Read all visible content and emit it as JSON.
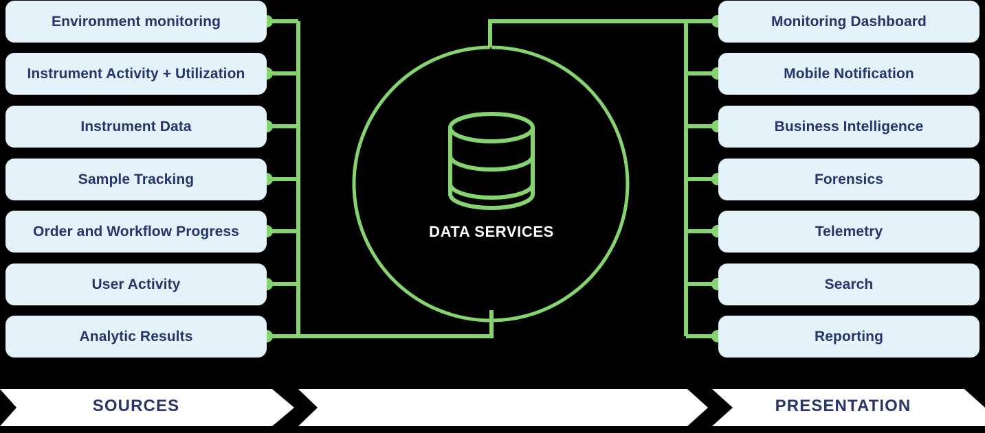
{
  "diagram": {
    "title": "Data Services architecture diagram",
    "colors": {
      "background": "#000000",
      "card_fill": "#e4f3fa",
      "card_text": "#27356c",
      "accent_green": "#85d46f",
      "hub_text": "#ffffff",
      "banner_fill": "#ffffff",
      "banner_text": "#27356c"
    }
  },
  "sources": {
    "banner_label": "SOURCES",
    "items": [
      {
        "label": "Environment monitoring"
      },
      {
        "label": "Instrument Activity + Utilization"
      },
      {
        "label": "Instrument Data"
      },
      {
        "label": "Sample Tracking"
      },
      {
        "label": "Order and Workflow Progress"
      },
      {
        "label": "User Activity"
      },
      {
        "label": "Analytic Results"
      }
    ]
  },
  "hub": {
    "banner_label": "",
    "label": "DATA SERVICES",
    "icon": "database-cylinder-icon"
  },
  "presentation": {
    "banner_label": "PRESENTATION",
    "items": [
      {
        "label": "Monitoring Dashboard"
      },
      {
        "label": "Mobile Notification"
      },
      {
        "label": "Business Intelligence"
      },
      {
        "label": "Forensics"
      },
      {
        "label": "Telemetry"
      },
      {
        "label": "Search"
      },
      {
        "label": "Reporting"
      }
    ]
  }
}
